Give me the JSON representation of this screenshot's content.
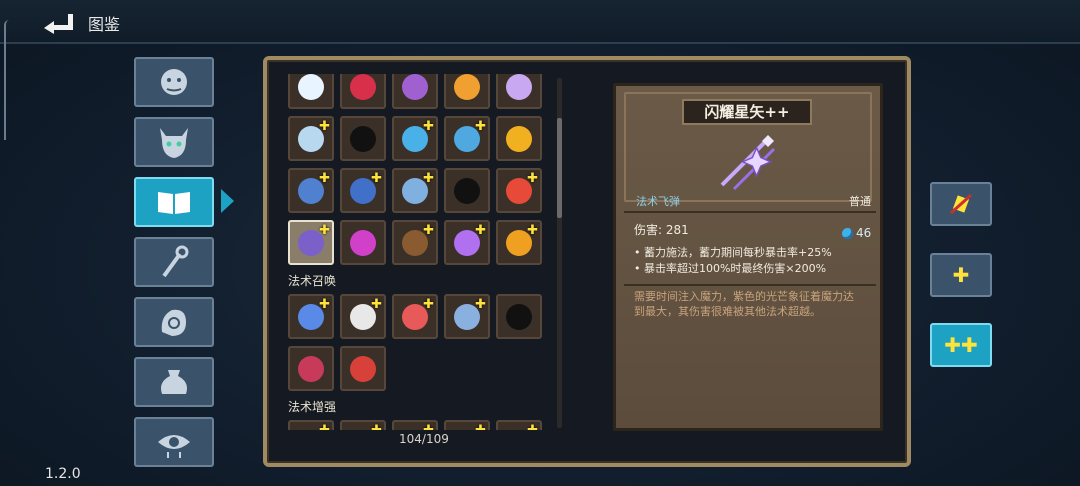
{
  "header": {
    "title": "图鉴",
    "back_icon": "back-arrow-icon"
  },
  "version": "1.2.0",
  "sidebar": {
    "items": [
      {
        "name": "sidebar-item-monsters",
        "icon": "demon-face-icon",
        "active": false
      },
      {
        "name": "sidebar-item-bosses",
        "icon": "horned-demon-icon",
        "active": false
      },
      {
        "name": "sidebar-item-spellbook",
        "icon": "open-book-icon",
        "active": true
      },
      {
        "name": "sidebar-item-staffs",
        "icon": "staff-icon",
        "active": false
      },
      {
        "name": "sidebar-item-relics",
        "icon": "hand-rune-icon",
        "active": false
      },
      {
        "name": "sidebar-item-potions",
        "icon": "pouch-icon",
        "active": false
      },
      {
        "name": "sidebar-item-curses",
        "icon": "eye-icon",
        "active": false
      }
    ]
  },
  "grid": {
    "sections": [
      {
        "label": "",
        "rows": [
          [
            {
              "c": "#e8f4ff",
              "p": false
            },
            {
              "c": "#d8304a",
              "p": false
            },
            {
              "c": "#a060d0",
              "p": false
            },
            {
              "c": "#f0a030",
              "p": false
            },
            {
              "c": "#c8a8f0",
              "p": false
            }
          ],
          [
            {
              "c": "#b8d8f0",
              "p": true
            },
            {
              "c": "#111111",
              "p": false
            },
            {
              "c": "#4ab0e8",
              "p": true
            },
            {
              "c": "#50a8e0",
              "p": true
            },
            {
              "c": "#f0b020",
              "p": false
            }
          ],
          [
            {
              "c": "#5080d0",
              "p": true
            },
            {
              "c": "#4070c8",
              "p": true
            },
            {
              "c": "#80b0e0",
              "p": true
            },
            {
              "c": "#111111",
              "p": false
            },
            {
              "c": "#e84a3a",
              "p": true
            }
          ],
          [
            {
              "c": "#7a60c8",
              "p": true,
              "selected": true
            },
            {
              "c": "#d040c8",
              "p": false
            },
            {
              "c": "#8a5a30",
              "p": true
            },
            {
              "c": "#b070f0",
              "p": true
            },
            {
              "c": "#f0a020",
              "p": true
            }
          ]
        ]
      },
      {
        "label": "法术召唤",
        "rows": [
          [
            {
              "c": "#5a8ae8",
              "p": true
            },
            {
              "c": "#e8e8e8",
              "p": true
            },
            {
              "c": "#e85a5a",
              "p": true
            },
            {
              "c": "#8ab0e0",
              "p": true
            },
            {
              "c": "#111111",
              "p": false
            }
          ],
          [
            {
              "c": "#c83a5a",
              "p": false
            },
            {
              "c": "#d8403a",
              "p": false
            }
          ]
        ]
      },
      {
        "label": "法术增强",
        "rows": [
          [
            {
              "c": "#e84a3a",
              "p": true
            },
            {
              "c": "#e8603a",
              "p": true
            },
            {
              "c": "#d05030",
              "p": true
            },
            {
              "c": "#e8a030",
              "p": true
            },
            {
              "c": "#50c050",
              "p": true
            }
          ]
        ]
      }
    ],
    "count": "104/109"
  },
  "detail": {
    "name": "闪耀星矢++",
    "type": "法术飞弹",
    "rarity": "普通",
    "stat_label": "伤害: 281",
    "mana_cost": "46",
    "effects": [
      "• 蓄力施法，蓄力期间每秒暴击率+25%",
      "• 暴击率超过100%时最终伤害×200%"
    ],
    "description": "需要时间注入魔力，紫色的光芒象征着魔力达到最大，其伤害很难被其他法术超越。"
  },
  "right_buttons": [
    {
      "name": "upgrade-level-0-button",
      "label": "",
      "active": false
    },
    {
      "name": "upgrade-level-1-button",
      "label": "✚",
      "active": false
    },
    {
      "name": "upgrade-level-2-button",
      "label": "✚✚",
      "active": true
    }
  ],
  "colors": {
    "accent": "#1ea2c4",
    "panel_border": "#a08a62",
    "card": "#6b5a47"
  }
}
